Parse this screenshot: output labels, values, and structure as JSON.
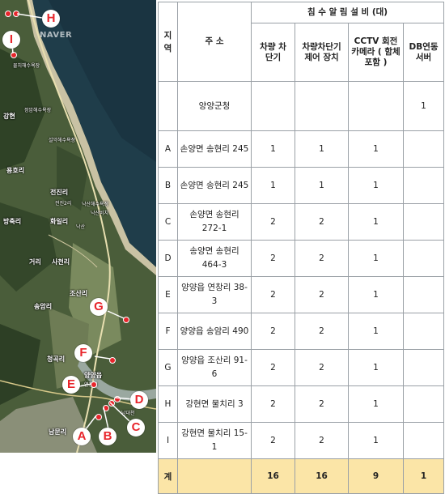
{
  "map": {
    "watermark": "NAVER",
    "labels": [
      "물치해수욕장",
      "정암해수욕장",
      "설악해수욕장",
      "낙산해수욕장",
      "낙산비치",
      "용호리",
      "전진리",
      "전진2리",
      "낙산",
      "방축리",
      "화일리",
      "강현",
      "거리",
      "사천리",
      "조산리",
      "송암리",
      "청곡리",
      "양양읍",
      "연창리",
      "남문리",
      "남대천"
    ],
    "markers": [
      "H",
      "I",
      "G",
      "F",
      "E",
      "D",
      "C",
      "B",
      "A"
    ]
  },
  "table": {
    "header_region": "지역",
    "header_address": "주 소",
    "header_group": "침 수 알 림 설 비 (대)",
    "col_barrier": "차량 차단기",
    "col_barrier_ctrl": "차량차단기 제어 장치",
    "col_cctv": "CCTV 회전 카메라 ( 함체포함 )",
    "col_db": "DB연동 서버",
    "rows": [
      {
        "region": "",
        "address": "양양군청",
        "barrier": "",
        "control": "",
        "cctv": "",
        "db": "1"
      },
      {
        "region": "A",
        "address": "손양면 송현리 245",
        "barrier": "1",
        "control": "1",
        "cctv": "1",
        "db": ""
      },
      {
        "region": "B",
        "address": "손양면 송현리 245",
        "barrier": "1",
        "control": "1",
        "cctv": "1",
        "db": ""
      },
      {
        "region": "C",
        "address": "손양면 송현리 272-1",
        "barrier": "2",
        "control": "2",
        "cctv": "1",
        "db": ""
      },
      {
        "region": "D",
        "address": "송양면 송현리 464-3",
        "barrier": "2",
        "control": "2",
        "cctv": "1",
        "db": ""
      },
      {
        "region": "E",
        "address": "양양읍 연창리 38-3",
        "barrier": "2",
        "control": "2",
        "cctv": "1",
        "db": ""
      },
      {
        "region": "F",
        "address": "양양읍 송암리 490",
        "barrier": "2",
        "control": "2",
        "cctv": "1",
        "db": ""
      },
      {
        "region": "G",
        "address": "양양읍 조산리 91-6",
        "barrier": "2",
        "control": "2",
        "cctv": "1",
        "db": ""
      },
      {
        "region": "H",
        "address": "강현면 물치리 3",
        "barrier": "2",
        "control": "2",
        "cctv": "1",
        "db": ""
      },
      {
        "region": "I",
        "address": "강현면 물치리 15-1",
        "barrier": "2",
        "control": "2",
        "cctv": "1",
        "db": ""
      }
    ],
    "total": {
      "label": "계",
      "barrier": "16",
      "control": "16",
      "cctv": "9",
      "db": "1"
    }
  }
}
